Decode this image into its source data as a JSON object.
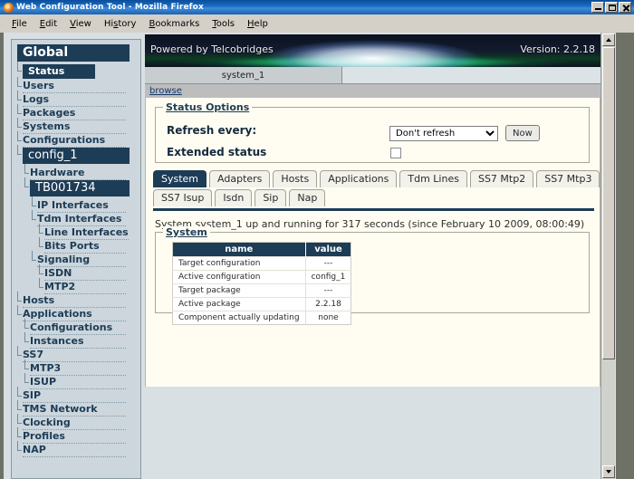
{
  "window": {
    "title": "Web Configuration Tool - Mozilla Firefox",
    "minimize_label": "Minimize",
    "maximize_label": "Maximize",
    "close_label": "Close"
  },
  "menubar": [
    {
      "label": "File",
      "accel": "F"
    },
    {
      "label": "Edit",
      "accel": "E"
    },
    {
      "label": "View",
      "accel": "V"
    },
    {
      "label": "History",
      "accel": "s"
    },
    {
      "label": "Bookmarks",
      "accel": "B"
    },
    {
      "label": "Tools",
      "accel": "T"
    },
    {
      "label": "Help",
      "accel": "H"
    }
  ],
  "sidebar": {
    "items": [
      {
        "label": "Global",
        "style": "header-big",
        "indent": 0,
        "selected": false
      },
      {
        "label": "Status",
        "style": "header-sm",
        "indent": 1,
        "selected": true
      },
      {
        "label": "Users",
        "style": "plain",
        "indent": 1,
        "selected": false
      },
      {
        "label": "Logs",
        "style": "plain",
        "indent": 1,
        "selected": false
      },
      {
        "label": "Packages",
        "style": "plain",
        "indent": 1,
        "selected": false
      },
      {
        "label": "Systems",
        "style": "plain",
        "indent": 1,
        "selected": false
      },
      {
        "label": "Configurations",
        "style": "plain",
        "indent": 1,
        "selected": false
      },
      {
        "label": "config_1",
        "style": "header-mid",
        "indent": 1,
        "selected": false
      },
      {
        "label": "Hardware",
        "style": "plain",
        "indent": 2,
        "selected": false
      },
      {
        "label": "TB001734",
        "style": "header-mid",
        "indent": 2,
        "selected": false
      },
      {
        "label": "IP Interfaces",
        "style": "plain",
        "indent": 3,
        "selected": false
      },
      {
        "label": "Tdm Interfaces",
        "style": "plain",
        "indent": 3,
        "selected": false
      },
      {
        "label": "Line Interfaces",
        "style": "plain",
        "indent": 4,
        "selected": false
      },
      {
        "label": "Bits Ports",
        "style": "plain",
        "indent": 4,
        "selected": false
      },
      {
        "label": "Signaling",
        "style": "plain",
        "indent": 3,
        "selected": false
      },
      {
        "label": "ISDN",
        "style": "plain",
        "indent": 4,
        "selected": false
      },
      {
        "label": "MTP2",
        "style": "plain",
        "indent": 4,
        "selected": false
      },
      {
        "label": "Hosts",
        "style": "plain",
        "indent": 1,
        "selected": false
      },
      {
        "label": "Applications",
        "style": "plain",
        "indent": 1,
        "selected": false
      },
      {
        "label": "Configurations",
        "style": "plain",
        "indent": 2,
        "selected": false
      },
      {
        "label": "Instances",
        "style": "plain",
        "indent": 2,
        "selected": false
      },
      {
        "label": "SS7",
        "style": "plain",
        "indent": 1,
        "selected": false
      },
      {
        "label": "MTP3",
        "style": "plain",
        "indent": 2,
        "selected": false
      },
      {
        "label": "ISUP",
        "style": "plain",
        "indent": 2,
        "selected": false
      },
      {
        "label": "SIP",
        "style": "plain",
        "indent": 1,
        "selected": false
      },
      {
        "label": "TMS Network",
        "style": "plain",
        "indent": 1,
        "selected": false
      },
      {
        "label": "Clocking",
        "style": "plain",
        "indent": 1,
        "selected": false
      },
      {
        "label": "Profiles",
        "style": "plain",
        "indent": 1,
        "selected": false
      },
      {
        "label": "NAP",
        "style": "plain",
        "indent": 1,
        "selected": false
      }
    ]
  },
  "banner": {
    "powered_by": "Powered by Telcobridges",
    "version": "Version: 2.2.18"
  },
  "toolstrip": {
    "document_tab": "system_1",
    "browse_link": "browse"
  },
  "status_options": {
    "legend": "Status Options",
    "refresh_label": "Refresh every:",
    "refresh_selected": "Don't refresh",
    "refresh_options": [
      "Don't refresh"
    ],
    "now_button": "Now",
    "extended_label": "Extended status",
    "extended_checked": false
  },
  "tabs": {
    "row1": [
      "System",
      "Adapters",
      "Hosts",
      "Applications",
      "Tdm Lines",
      "SS7 Mtp2",
      "SS7 Mtp3"
    ],
    "row2": [
      "SS7 Isup",
      "Isdn",
      "Sip",
      "Nap"
    ],
    "active": "System"
  },
  "status_line": "System system_1 up and running for 317 seconds (since February 10 2009, 08:00:49)",
  "system_panel": {
    "legend": "System",
    "columns": [
      "name",
      "value"
    ],
    "rows": [
      {
        "name": "Target configuration",
        "value": "---"
      },
      {
        "name": "Active configuration",
        "value": "config_1"
      },
      {
        "name": "Target package",
        "value": "---"
      },
      {
        "name": "Active package",
        "value": "2.2.18"
      },
      {
        "name": "Component actually updating",
        "value": "none"
      }
    ]
  },
  "colors": {
    "accent_dark": "#1d3c56",
    "sidebar_bg": "#ccd6dc",
    "panel_bg": "#fffdf2",
    "page_bg": "#d9e0e4"
  }
}
